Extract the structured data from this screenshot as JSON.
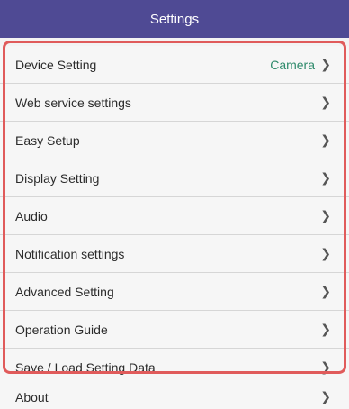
{
  "header": {
    "title": "Settings"
  },
  "colors": {
    "header_bg": "#4f4a94",
    "accent_value": "#2e8a6b",
    "highlight_border": "#e05b5b"
  },
  "icons": {
    "chevron": "chevron-right-icon"
  },
  "menu": {
    "items": [
      {
        "label": "Device Setting",
        "value": "Camera"
      },
      {
        "label": "Web service settings"
      },
      {
        "label": "Easy Setup"
      },
      {
        "label": "Display Setting"
      },
      {
        "label": "Audio"
      },
      {
        "label": "Notification settings"
      },
      {
        "label": "Advanced Setting"
      },
      {
        "label": "Operation Guide"
      },
      {
        "label": "Save / Load Setting Data"
      },
      {
        "label": "About"
      }
    ]
  }
}
